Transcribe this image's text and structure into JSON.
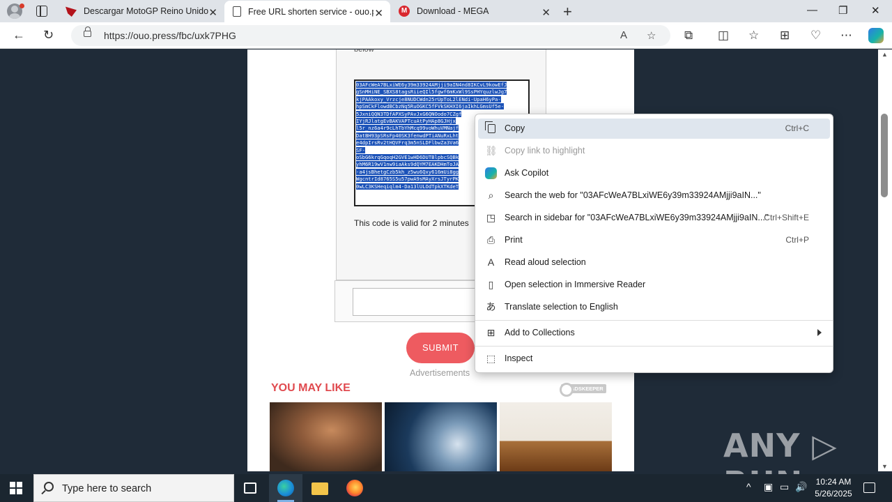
{
  "browser": {
    "tabs": [
      {
        "title": "Descargar MotoGP Reino Unido (",
        "close": "✕"
      },
      {
        "title": "Free URL shorten service - ouo.pr",
        "close": "✕"
      },
      {
        "title": "Download - MEGA",
        "close": "✕"
      }
    ],
    "mega_letter": "M",
    "new_tab": "+",
    "window": {
      "minimize": "—",
      "maximize": "❐",
      "close": "✕"
    },
    "nav": {
      "back": "←",
      "reload": "↻"
    },
    "url": "https://ouo.press/fbc/uxk7PHG",
    "address_icons": {
      "read_aloud": "A",
      "favorite": "☆"
    },
    "toolbar_icons": {
      "extensions": "⧉",
      "split": "◫",
      "favorites": "☆",
      "collections": "⊞",
      "performance": "♡",
      "more": "⋯"
    }
  },
  "page": {
    "label_below": "below",
    "code_lines": [
      "03AFcWeA7BLxiWE6y39m33924AMjji9aIN4nd8IKCvL9kowEfJ",
      "gSnMHiNE_SBXS8tagsRiieQIl5fgwf6mKxWl9SsPHYquzlwJg7",
      "kjPAAkoxy_Vrzcje8NUDCWdn25rUpToL2lENdi-UpaH6yPa-",
      "hpSmCkFlowdBCbzNq5RuOGKC5fFVkSKHXI6jaIkhLGmsUf5e-",
      "5JxniQQN3TDfAPXSyPAvJxG6QNOodo7CZgf",
      "IYjRJlatgEvBAKVAPTcuAtPyHAp8GJHjx",
      "l5r_nz6a4r9cLhTbYhMcq99voWhuVMNajf",
      "DatBH93pSRsFp40SK3fenwdPTiANuRxLht",
      "e4dpIrsRv2tHQVFrq3m5nSLDFlbwZa3Va6",
      "SF-",
      "oSbG6krqGqoqH2GVE1wHD6DUTBlpbcSQBk",
      "yhM6R19wV1nw9iaAks9dQYM7EAKDHmToJA",
      "-a4jsBhetgCzb5kh_z5wu6Qxy616mUi8gg",
      "WgcntrId8765S5u57pwA9sMAyXrsJTyrPK",
      "0wLC3KSHeqiqlm4-Da13lULOdTpkXTKdeT"
    ],
    "valid_text": "This code is valid for 2 minutes",
    "submit_label": "SUBMIT",
    "ads_label": "Advertisements",
    "you_may_like": "YOU MAY LIKE",
    "adskeeper": "ADSKEEPER"
  },
  "context_menu": {
    "items": [
      {
        "label": "Copy",
        "shortcut": "Ctrl+C",
        "icon": "copy-icon",
        "disabled": false,
        "highlighted": true
      },
      {
        "label": "Copy link to highlight",
        "shortcut": "",
        "icon": "link-highlight-icon",
        "disabled": true
      },
      {
        "label": "Ask Copilot",
        "shortcut": "",
        "icon": "copilot-icon",
        "disabled": false
      },
      {
        "label": "Search the web for \"03AFcWeA7BLxiWE6y39m33924AMjji9aIN...\"",
        "shortcut": "",
        "icon": "search-icon",
        "disabled": false
      },
      {
        "label": "Search in sidebar for \"03AFcWeA7BLxiWE6y39m33924AMjji9aIN...\"",
        "shortcut": "Ctrl+Shift+E",
        "icon": "sidebar-search-icon",
        "disabled": false
      },
      {
        "label": "Print",
        "shortcut": "Ctrl+P",
        "icon": "print-icon",
        "disabled": false
      },
      {
        "label": "Read aloud selection",
        "shortcut": "",
        "icon": "read-aloud-icon",
        "disabled": false
      },
      {
        "label": "Open selection in Immersive Reader",
        "shortcut": "",
        "icon": "immersive-reader-icon",
        "disabled": false
      },
      {
        "label": "Translate selection to English",
        "shortcut": "",
        "icon": "translate-icon",
        "disabled": false
      },
      {
        "label": "Add to Collections",
        "shortcut": "",
        "icon": "collections-icon",
        "disabled": false,
        "submenu": true
      },
      {
        "label": "Inspect",
        "shortcut": "",
        "icon": "inspect-icon",
        "disabled": false
      }
    ],
    "glyphs": {
      "search": "⌕",
      "print": "⎙",
      "read_aloud": "A",
      "translate": "あ"
    }
  },
  "watermark": "ANY ▷ RUN",
  "taskbar": {
    "search_placeholder": "Type here to search",
    "time": "10:24 AM",
    "date": "5/26/2025",
    "tray": {
      "chevron": "^",
      "volume": "🔊"
    }
  },
  "colors": {
    "accent": "#ee5b60",
    "selection": "#1b52b8",
    "dark_bg": "#1f2b38"
  }
}
